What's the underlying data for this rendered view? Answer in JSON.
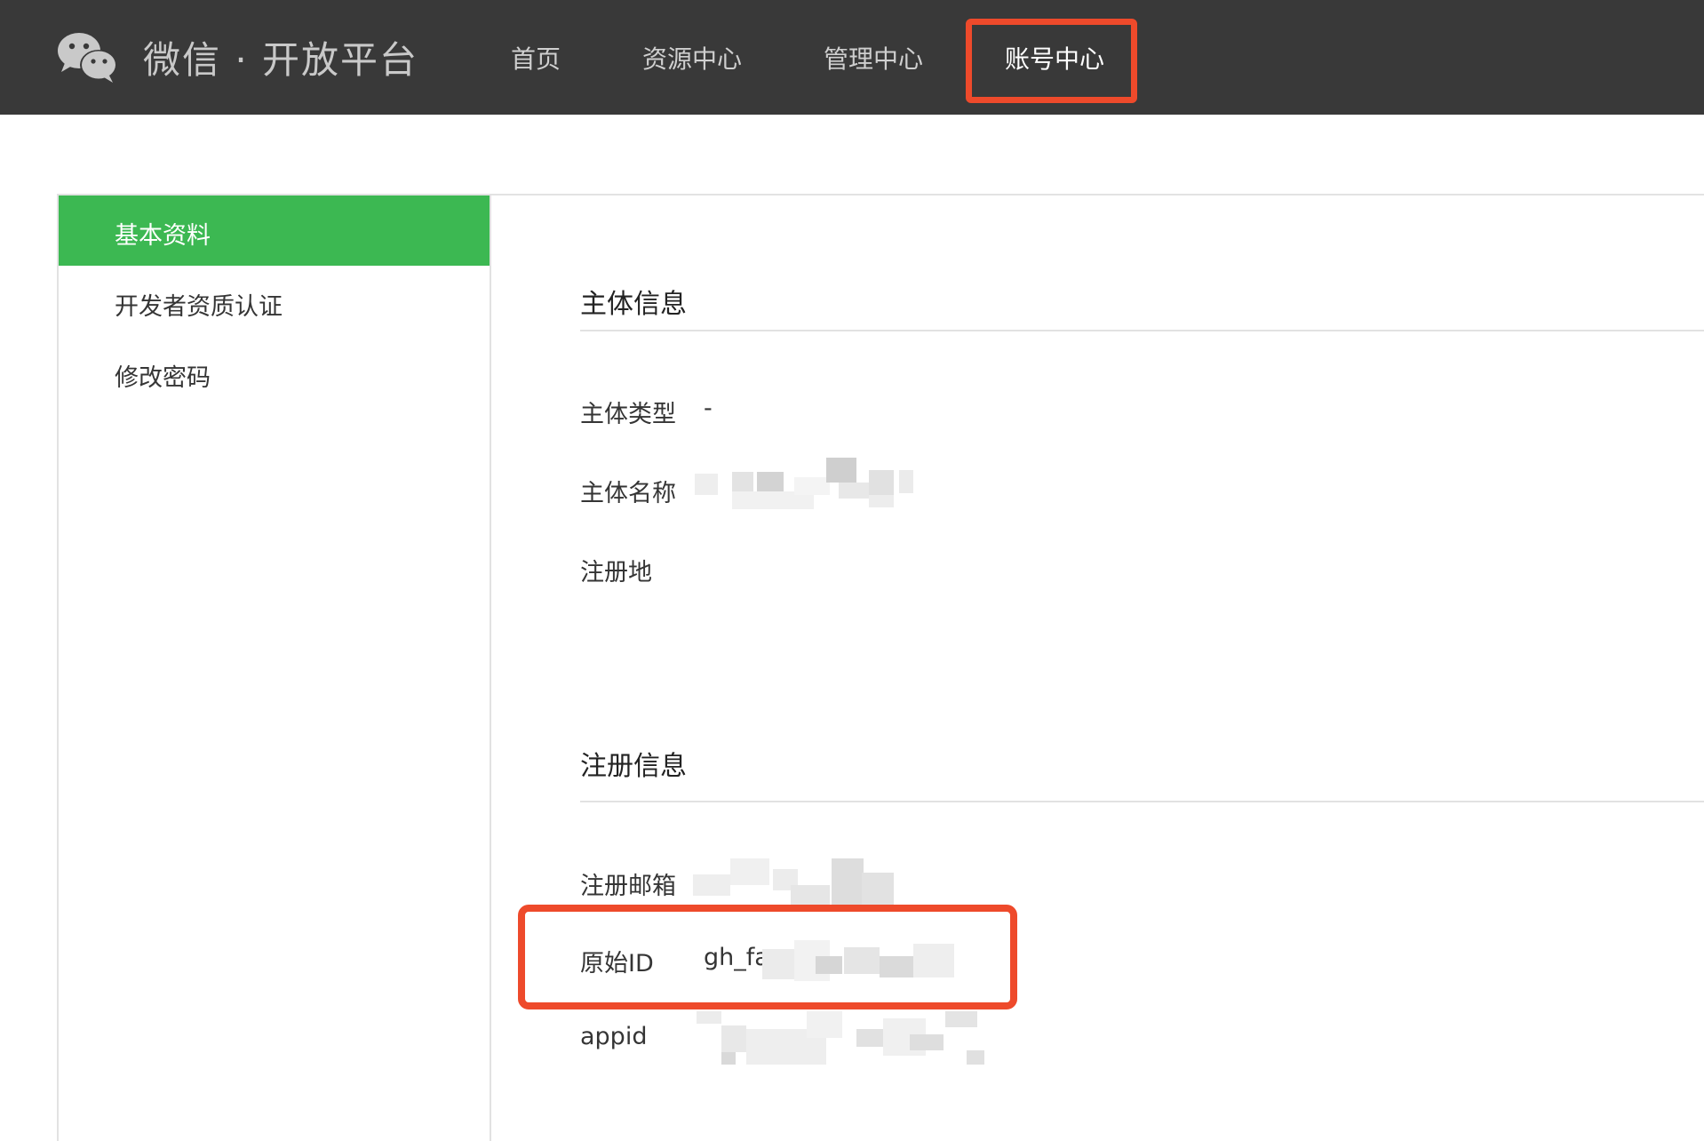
{
  "header": {
    "brand": "微信 · 开放平台",
    "nav": [
      "首页",
      "资源中心",
      "管理中心",
      "账号中心"
    ],
    "active_nav": "账号中心"
  },
  "sidebar": {
    "items": [
      "基本资料",
      "开发者资质认证",
      "修改密码"
    ],
    "active": "基本资料"
  },
  "main": {
    "subject_section": {
      "title": "主体信息",
      "fields": [
        {
          "label": "主体类型",
          "value": "-"
        },
        {
          "label": "主体名称",
          "value": ""
        },
        {
          "label": "注册地",
          "value": ""
        }
      ]
    },
    "register_section": {
      "title": "注册信息",
      "fields": [
        {
          "label": "注册邮箱",
          "value": ""
        },
        {
          "label": "原始ID",
          "value": "gh_fa"
        },
        {
          "label": "appid",
          "value": ""
        }
      ]
    }
  },
  "colors": {
    "topbar": "#393939",
    "active_green": "#3cb852",
    "highlight_red": "#ee4a2b"
  },
  "icons": {
    "logo": "wechat-logo-icon"
  }
}
